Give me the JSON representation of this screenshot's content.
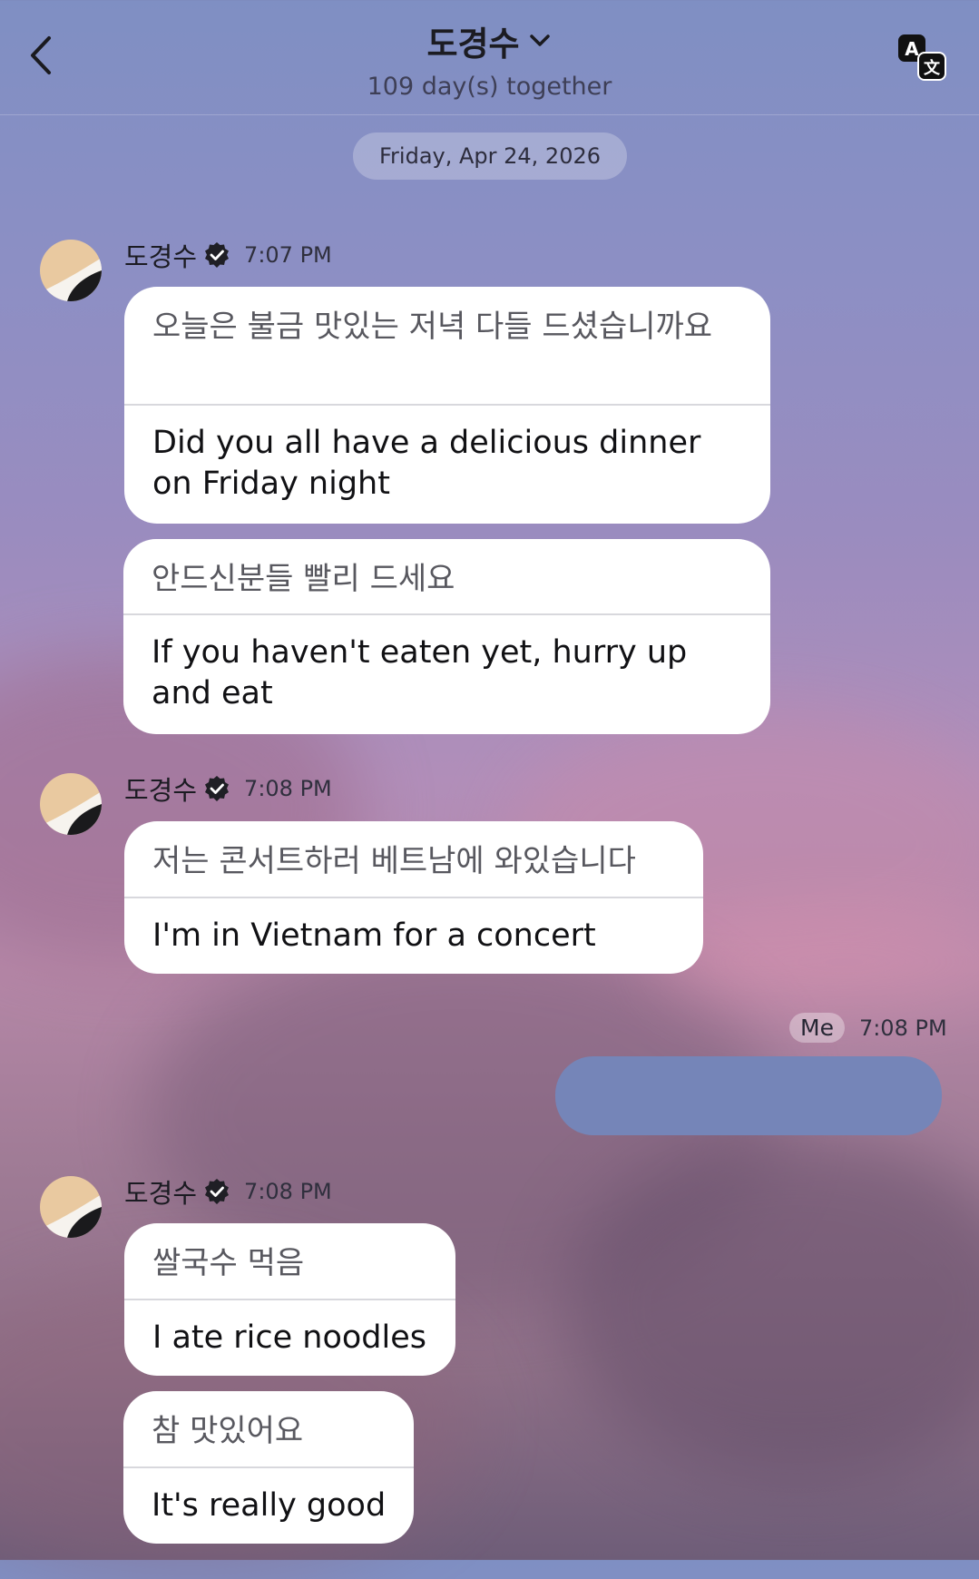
{
  "header": {
    "title": "도경수",
    "subtitle": "109 day(s) together",
    "back_icon": "chevron-left-icon",
    "translate_icon": "translate-icon",
    "dropdown_icon": "chevron-down-icon"
  },
  "date_separator": "Friday, Apr 24, 2026",
  "groups": [
    {
      "sender": "도경수",
      "time": "7:07 PM",
      "messages": [
        {
          "original": "오늘은 불금 맛있는 저녁 다들 드셨습니까요",
          "translation": "Did you all have a delicious dinner on Friday night"
        },
        {
          "original": "안드신분들 빨리 드세요",
          "translation": "If you haven't eaten yet, hurry up and eat"
        }
      ]
    },
    {
      "sender": "도경수",
      "time": "7:08 PM",
      "messages": [
        {
          "original": "저는 콘서트하러 베트남에 와있습니다",
          "translation": "I'm in Vietnam for a concert"
        }
      ]
    },
    {
      "sender": "도경수",
      "time": "7:08 PM",
      "messages": [
        {
          "original": "쌀국수 먹음",
          "translation": "I ate rice noodles"
        },
        {
          "original": "참 맛있어요",
          "translation": "It's really good"
        }
      ]
    }
  ],
  "my_message": {
    "label": "Me",
    "time": "7:08 PM",
    "bubble_color": "#7585b8"
  },
  "colors": {
    "bubble_background": "#ffffff",
    "verified_badge": "#1f1f25"
  }
}
